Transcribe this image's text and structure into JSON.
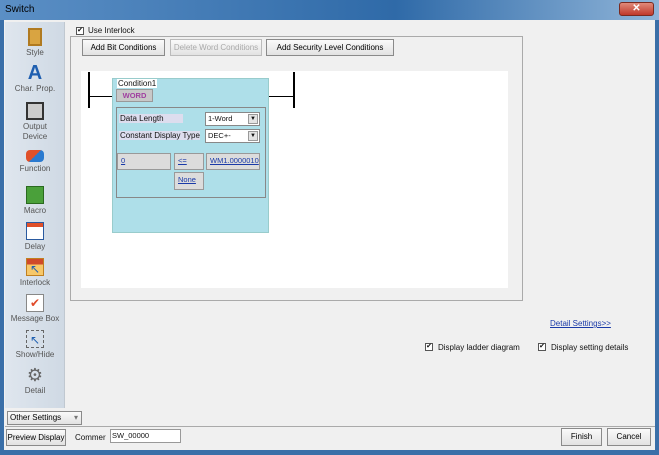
{
  "window": {
    "title": "Switch",
    "close": "✕"
  },
  "sidebar": {
    "items": [
      {
        "label": "Style",
        "icon": "clipboard-icon"
      },
      {
        "label": "Char. Prop.",
        "icon": "letter-a-icon"
      },
      {
        "label": "Output Device",
        "icon": "switch-device-icon"
      },
      {
        "label": "Function",
        "icon": "shapes-icon"
      },
      {
        "label": "Macro",
        "icon": "macro-icon"
      },
      {
        "label": "Delay",
        "icon": "delay-icon"
      },
      {
        "label": "Interlock",
        "icon": "interlock-icon"
      },
      {
        "label": "Message Box",
        "icon": "message-box-icon"
      },
      {
        "label": "Show/Hide",
        "icon": "show-hide-icon"
      },
      {
        "label": "Detail",
        "icon": "gear-icon"
      }
    ],
    "other_settings": "Other Settings"
  },
  "interlock": {
    "use_label": "Use Interlock",
    "checked": true,
    "buttons": {
      "add_bit": "Add Bit Conditions",
      "delete_word": "Delete Word Conditions",
      "add_security": "Add Security Level Conditions"
    },
    "condition": {
      "title": "Condition1",
      "type": "WORD",
      "data_length_label": "Data Length",
      "data_length_value": "1-Word",
      "display_type_label": "Constant Display Type",
      "display_type_value": "DEC+-",
      "value": "0",
      "operator": "<=",
      "device": "WM1.0000010",
      "none": "None"
    }
  },
  "detail_settings": "Detail Settings>>",
  "options": {
    "ladder": "Display ladder diagram",
    "details": "Display setting details"
  },
  "footer": {
    "preview": "Preview Display",
    "comment_label": "Commer",
    "comment_value": "SW_00000",
    "finish": "Finish",
    "cancel": "Cancel"
  }
}
